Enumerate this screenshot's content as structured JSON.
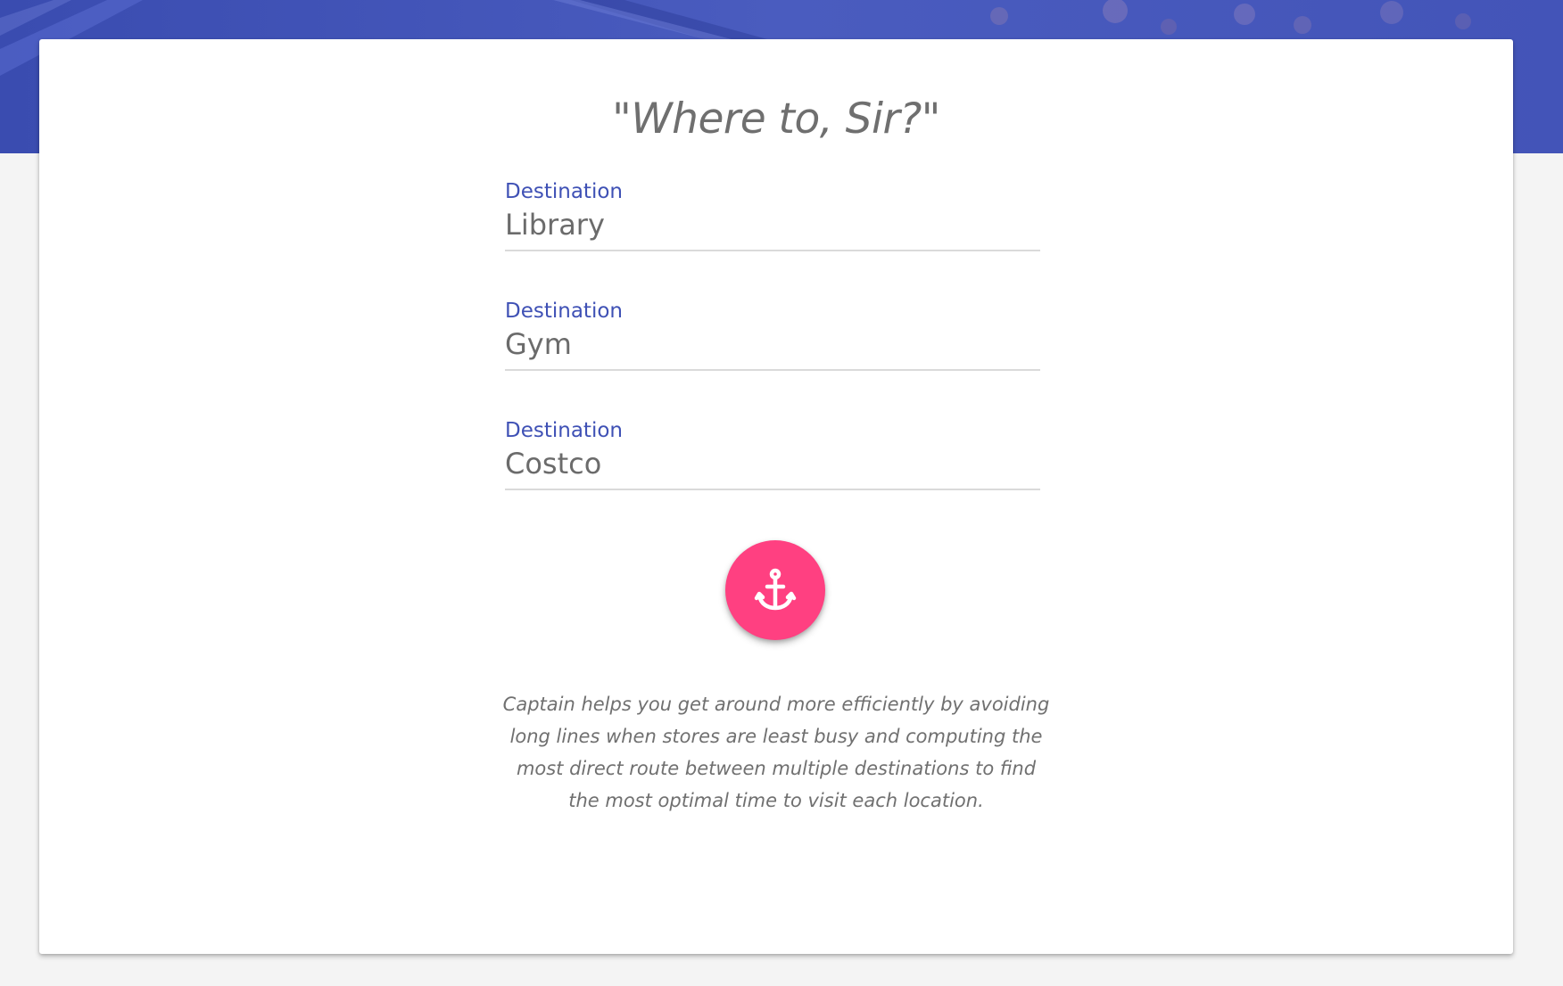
{
  "page": {
    "title": "\"Where to, Sir?\""
  },
  "fields": [
    {
      "label": "Destination",
      "value": "Library"
    },
    {
      "label": "Destination",
      "value": "Gym"
    },
    {
      "label": "Destination",
      "value": "Costco"
    }
  ],
  "action_button": {
    "icon": "anchor-icon"
  },
  "description": "Captain helps you get around more efficiently by avoiding long lines when stores are least busy and computing the most direct route between multiple destinations to find the most optimal time to visit each location.",
  "colors": {
    "primary": "#3f51b5",
    "accent": "#ff4081",
    "background": "#f4f4f4",
    "card": "#ffffff",
    "text": "#6f6f6f"
  }
}
